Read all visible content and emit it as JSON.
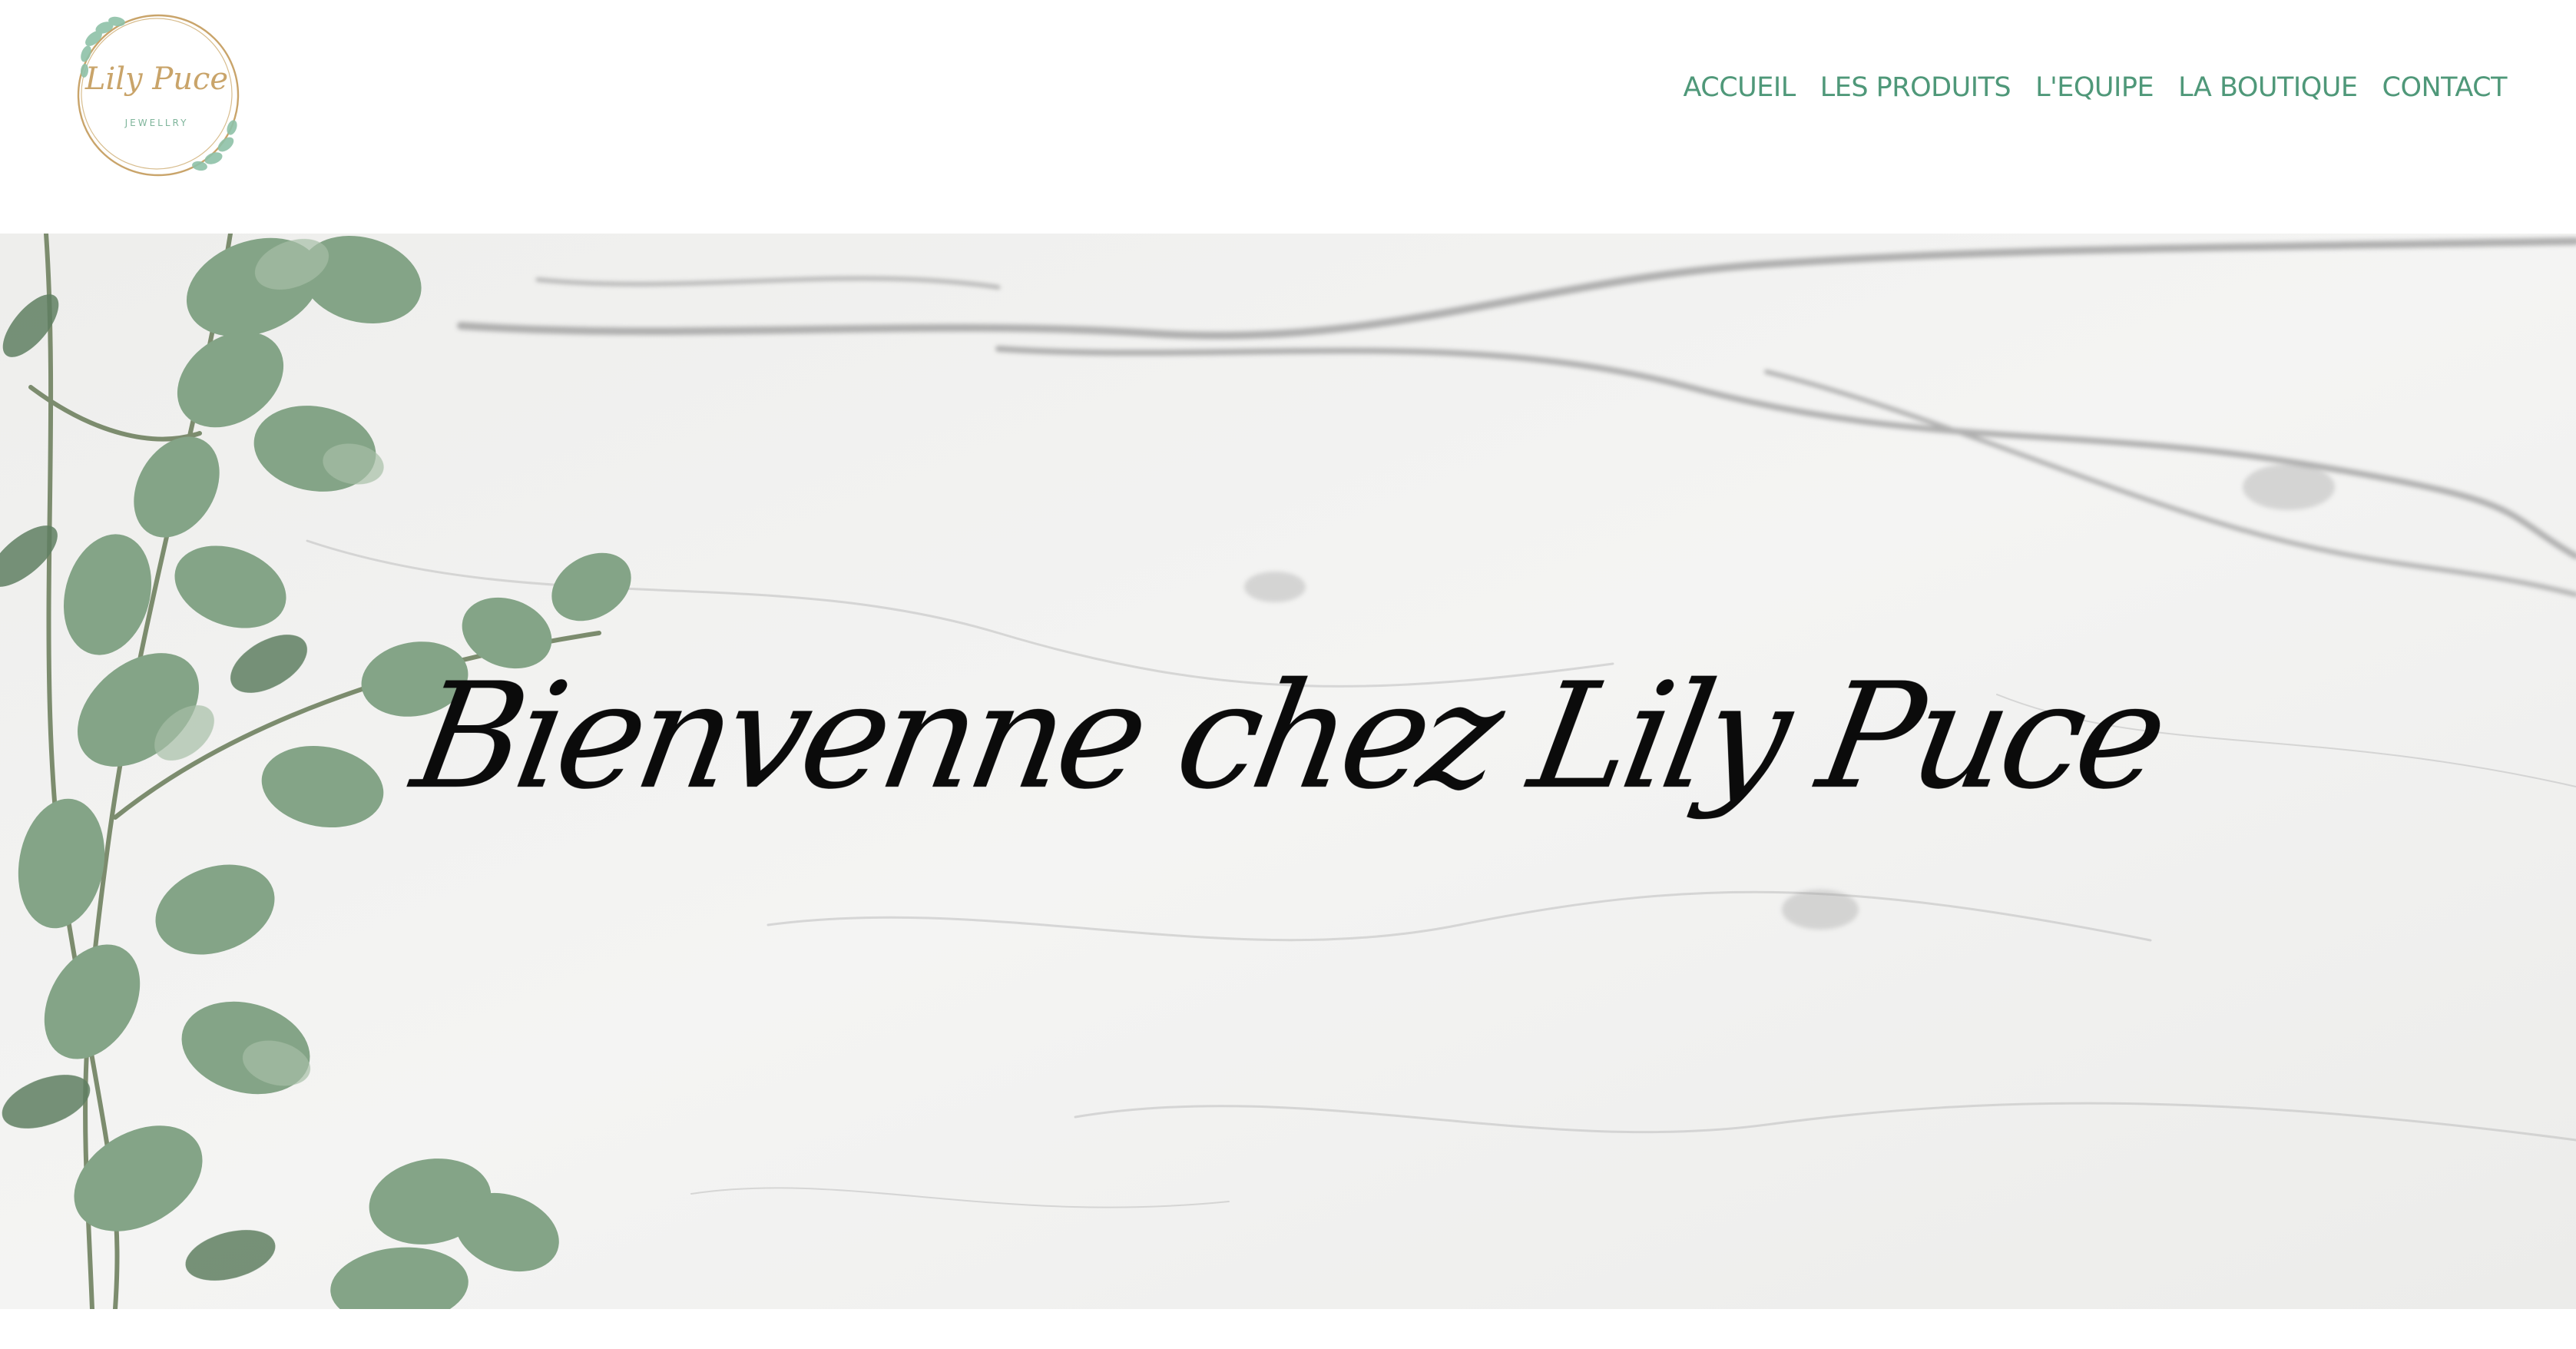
{
  "header": {
    "logo": {
      "name_text": "Lily Puce",
      "sub_text": "JEWELLRY"
    },
    "nav": [
      {
        "label": "ACCUEIL"
      },
      {
        "label": "LES PRODUITS"
      },
      {
        "label": "L'EQUIPE"
      },
      {
        "label": "LA BOUTIQUE"
      },
      {
        "label": "CONTACT"
      }
    ]
  },
  "hero": {
    "title": "Bienvenne chez Lily Puce"
  },
  "colors": {
    "nav_text": "#4f9879",
    "logo_gold": "#c9a46a",
    "leaf_green": "#7f9e84",
    "marble": "#f1f1f0",
    "title": "#0b0b0b"
  },
  "icons": [
    "eucalyptus-logo-icon",
    "eucalyptus-branch-image"
  ]
}
